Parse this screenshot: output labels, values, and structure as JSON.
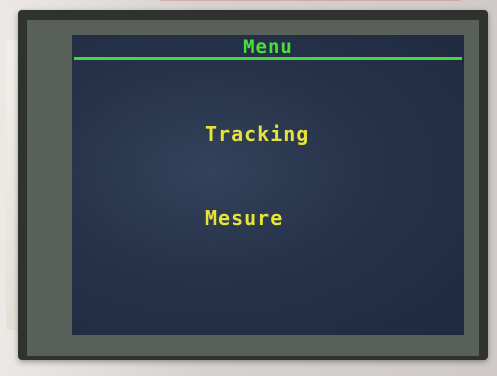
{
  "screen": {
    "title": "Menu",
    "items": [
      {
        "label": "Tracking"
      },
      {
        "label": "Mesure"
      }
    ]
  },
  "colors": {
    "title": "#48e03a",
    "items": "#e6e43a",
    "background": "#26324a"
  }
}
